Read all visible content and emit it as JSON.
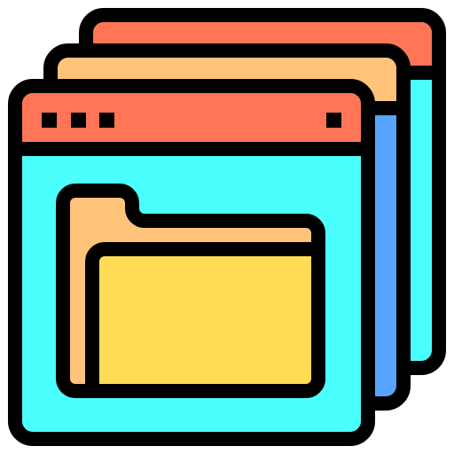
{
  "icon": {
    "name": "stacked-windows-folder-icon",
    "colors": {
      "outline": "#000000",
      "titlebar_red": "#FF7556",
      "titlebar_orange": "#FFC37A",
      "window_cyan": "#4CFFFF",
      "window_blue": "#57A4FF",
      "folder_back": "#FFC37A",
      "folder_front": "#FFDB56",
      "background": "#FFFFFF"
    }
  }
}
